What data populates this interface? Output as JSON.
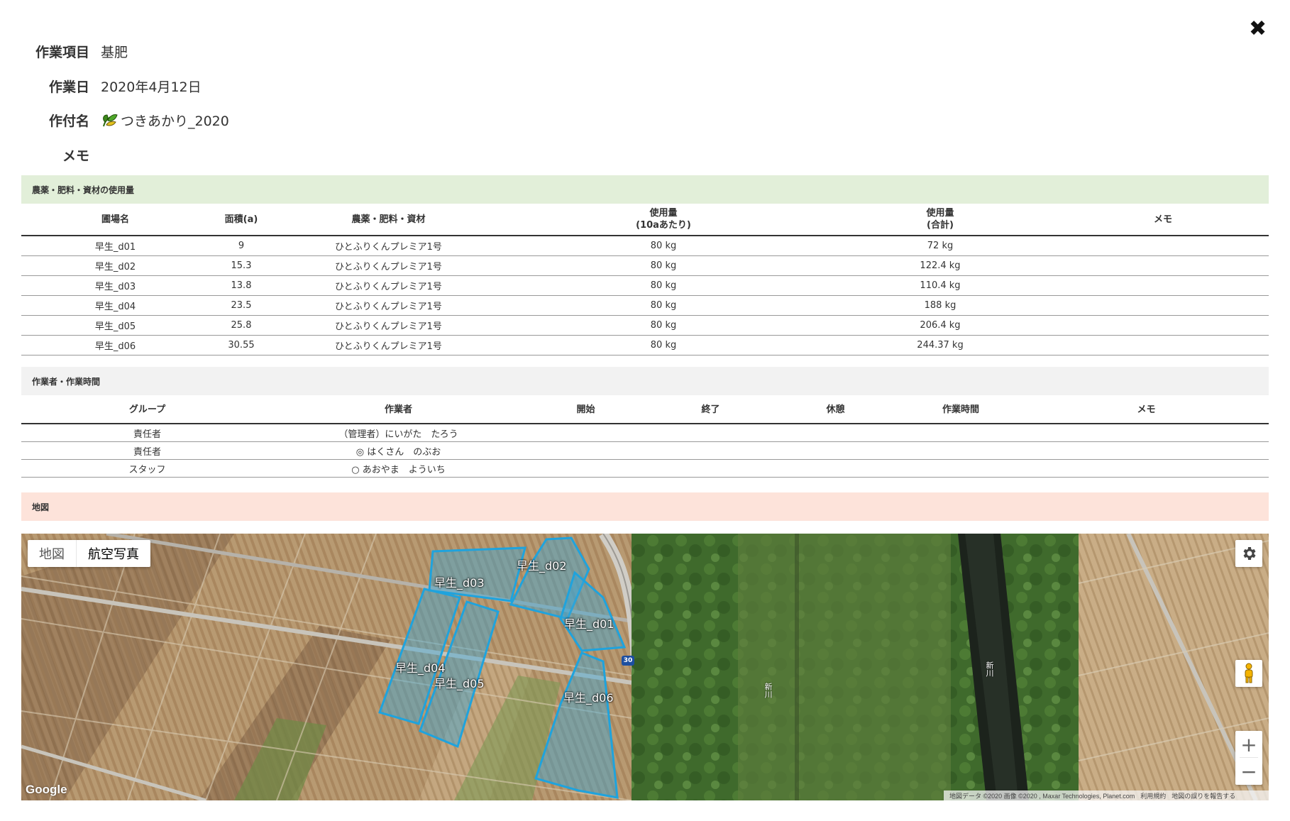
{
  "info": {
    "work_item_label": "作業項目",
    "work_item_value": "基肥",
    "date_label": "作業日",
    "date_value": "2020年4月12日",
    "crop_label": "作付名",
    "crop_value": "つきあかり_2020",
    "memo_label": "メモ",
    "memo_value": ""
  },
  "usage_section": {
    "title": "農薬・肥料・資材の使用量",
    "headers": {
      "field": "圃場名",
      "area": "面積(a)",
      "material": "農薬・肥料・資材",
      "per10a_line1": "使用量",
      "per10a_line2": "(10aあたり)",
      "total_line1": "使用量",
      "total_line2": "(合計)",
      "memo": "メモ"
    },
    "rows": [
      {
        "field": "早生_d01",
        "area": "9",
        "material": "ひとふりくんプレミア1号",
        "per10a": "80 kg",
        "total": "72 kg",
        "memo": ""
      },
      {
        "field": "早生_d02",
        "area": "15.3",
        "material": "ひとふりくんプレミア1号",
        "per10a": "80 kg",
        "total": "122.4 kg",
        "memo": ""
      },
      {
        "field": "早生_d03",
        "area": "13.8",
        "material": "ひとふりくんプレミア1号",
        "per10a": "80 kg",
        "total": "110.4 kg",
        "memo": ""
      },
      {
        "field": "早生_d04",
        "area": "23.5",
        "material": "ひとふりくんプレミア1号",
        "per10a": "80 kg",
        "total": "188 kg",
        "memo": ""
      },
      {
        "field": "早生_d05",
        "area": "25.8",
        "material": "ひとふりくんプレミア1号",
        "per10a": "80 kg",
        "total": "206.4 kg",
        "memo": ""
      },
      {
        "field": "早生_d06",
        "area": "30.55",
        "material": "ひとふりくんプレミア1号",
        "per10a": "80 kg",
        "total": "244.37 kg",
        "memo": ""
      }
    ]
  },
  "workers_section": {
    "title": "作業者・作業時間",
    "headers": {
      "group": "グループ",
      "worker": "作業者",
      "start": "開始",
      "end": "終了",
      "break": "休憩",
      "duration": "作業時間",
      "memo": "メモ"
    },
    "rows": [
      {
        "group": "責任者",
        "worker": "（管理者）にいがた　たろう",
        "start": "",
        "end": "",
        "break": "",
        "duration": "",
        "memo": ""
      },
      {
        "group": "責任者",
        "worker": "◎ はくさん　のぶお",
        "start": "",
        "end": "",
        "break": "",
        "duration": "",
        "memo": ""
      },
      {
        "group": "スタッフ",
        "worker": "○ あおやま　よういち",
        "start": "",
        "end": "",
        "break": "",
        "duration": "",
        "memo": ""
      }
    ]
  },
  "map_section": {
    "title": "地図",
    "type_map": "地図",
    "type_satellite": "航空写真",
    "google": "Google",
    "attribution": "地図データ ©2020 画像 ©2020 , Maxar Technologies, Planet.com",
    "terms": "利用規約",
    "report": "地図の誤りを報告する",
    "route_number": "30",
    "river_label_1": "新川",
    "river_label_2": "新川",
    "field_labels": {
      "d01": "早生_d01",
      "d02": "早生_d02",
      "d03": "早生_d03",
      "d04": "早生_d04",
      "d05": "早生_d05",
      "d06": "早生_d06"
    }
  },
  "icons": {
    "close": "close-icon",
    "crop": "crop-leaf-icon",
    "settings": "gear-icon",
    "pegman": "pegman-icon",
    "zoom_in": "plus-icon",
    "zoom_out": "minus-icon"
  },
  "colors": {
    "usage_bar": "#e2efd9",
    "workers_bar": "#f2f2f2",
    "map_bar": "#fde3da",
    "field_outline": "#22aadd"
  }
}
